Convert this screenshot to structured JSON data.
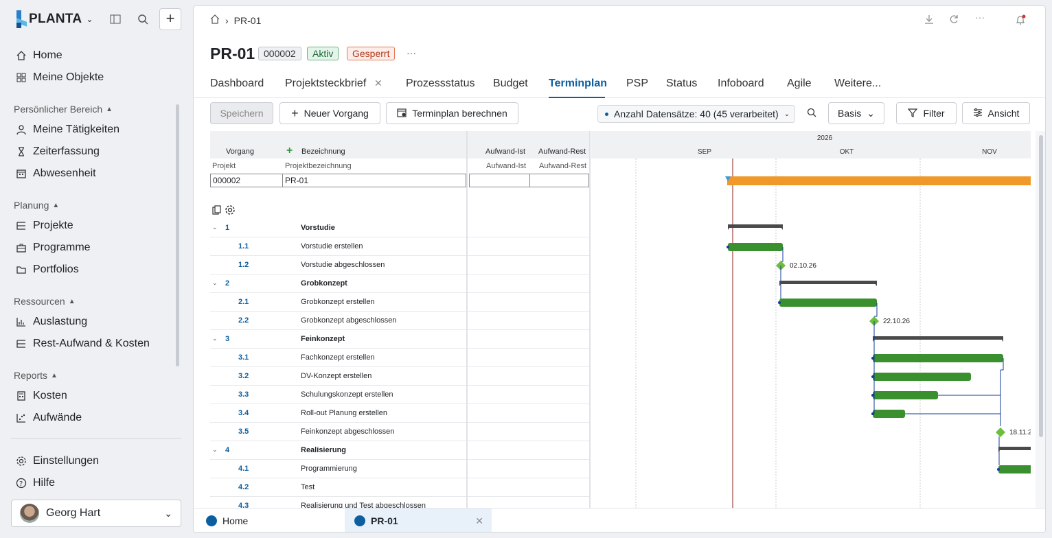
{
  "app": {
    "brand": "PLANTA"
  },
  "sidebar": {
    "items_top": [
      {
        "label": "Home",
        "icon": "home-icon"
      },
      {
        "label": "Meine Objekte",
        "icon": "grid-icon"
      }
    ],
    "sections": [
      {
        "title": "Persönlicher Bereich",
        "items": [
          {
            "label": "Meine Tätigkeiten",
            "icon": "user-icon"
          },
          {
            "label": "Zeiterfassung",
            "icon": "hourglass-icon"
          },
          {
            "label": "Abwesenheit",
            "icon": "calendar-icon"
          }
        ]
      },
      {
        "title": "Planung",
        "items": [
          {
            "label": "Projekte",
            "icon": "list-tree-icon"
          },
          {
            "label": "Programme",
            "icon": "briefcase-icon"
          },
          {
            "label": "Portfolios",
            "icon": "folder-icon"
          }
        ]
      },
      {
        "title": "Ressourcen",
        "items": [
          {
            "label": "Auslastung",
            "icon": "bar-chart-icon"
          },
          {
            "label": "Rest-Aufwand & Kosten",
            "icon": "list-tree-icon"
          }
        ]
      },
      {
        "title": "Reports",
        "items": [
          {
            "label": "Kosten",
            "icon": "calculator-icon"
          },
          {
            "label": "Aufwände",
            "icon": "scatter-icon"
          }
        ]
      }
    ],
    "settings": "Einstellungen",
    "help": "Hilfe",
    "user": "Georg Hart"
  },
  "breadcrumb": {
    "current": "PR-01"
  },
  "project": {
    "id": "PR-01",
    "number": "000002",
    "status_active": "Aktiv",
    "status_locked": "Gesperrt",
    "more": "···"
  },
  "tabs": [
    "Dashboard",
    "Projektsteckbrief",
    "Prozessstatus",
    "Budget",
    "Terminplan",
    "PSP",
    "Status",
    "Infoboard",
    "Agile",
    "Weitere..."
  ],
  "toolbar": {
    "save": "Speichern",
    "new": "Neuer Vorgang",
    "calc": "Terminplan berechnen",
    "records": "Anzahl Datensätze: 40 (45 verarbeitet)",
    "basis": "Basis",
    "filter": "Filter",
    "view": "Ansicht"
  },
  "table": {
    "headers": {
      "vorgang": "Vorgang",
      "bezeichnung": "Bezeichnung",
      "ist": "Aufwand-Ist",
      "rest": "Aufwand-Rest",
      "projekt": "Projekt",
      "projektbez": "Projektbezeichnung",
      "ist2": "Aufwand-Ist",
      "rest2": "Aufwand-Rest"
    },
    "project_row": {
      "projekt": "000002",
      "bez": "PR-01"
    },
    "rows": [
      {
        "no": "1",
        "desc": "Vorstudie",
        "group": true
      },
      {
        "no": "1.1",
        "desc": "Vorstudie erstellen"
      },
      {
        "no": "1.2",
        "desc": "Vorstudie abgeschlossen"
      },
      {
        "no": "2",
        "desc": "Grobkonzept",
        "group": true
      },
      {
        "no": "2.1",
        "desc": "Grobkonzept erstellen"
      },
      {
        "no": "2.2",
        "desc": "Grobkonzept abgeschlossen"
      },
      {
        "no": "3",
        "desc": "Feinkonzept",
        "group": true
      },
      {
        "no": "3.1",
        "desc": "Fachkonzept erstellen"
      },
      {
        "no": "3.2",
        "desc": "DV-Konzept erstellen"
      },
      {
        "no": "3.3",
        "desc": "Schulungskonzept erstellen"
      },
      {
        "no": "3.4",
        "desc": "Roll-out Planung erstellen"
      },
      {
        "no": "3.5",
        "desc": "Feinkonzept abgeschlossen"
      },
      {
        "no": "4",
        "desc": "Realisierung",
        "group": true
      },
      {
        "no": "4.1",
        "desc": "Programmierung"
      },
      {
        "no": "4.2",
        "desc": "Test"
      },
      {
        "no": "4.3",
        "desc": "Realisierung und Test abgeschlossen"
      }
    ]
  },
  "gantt": {
    "year": "2026",
    "months": [
      "SEP",
      "OKT",
      "NOV"
    ],
    "milestones": [
      "02.10.26",
      "22.10.26",
      "18.11.2"
    ]
  },
  "bottom_tabs": [
    "Home",
    "PR-01"
  ],
  "colors": {
    "accent": "#0b5fa0",
    "bar_green": "#3a8f2e",
    "bar_orange": "#f0982a",
    "milestone": "#6cbf3c",
    "summary": "#4a4a4a"
  }
}
